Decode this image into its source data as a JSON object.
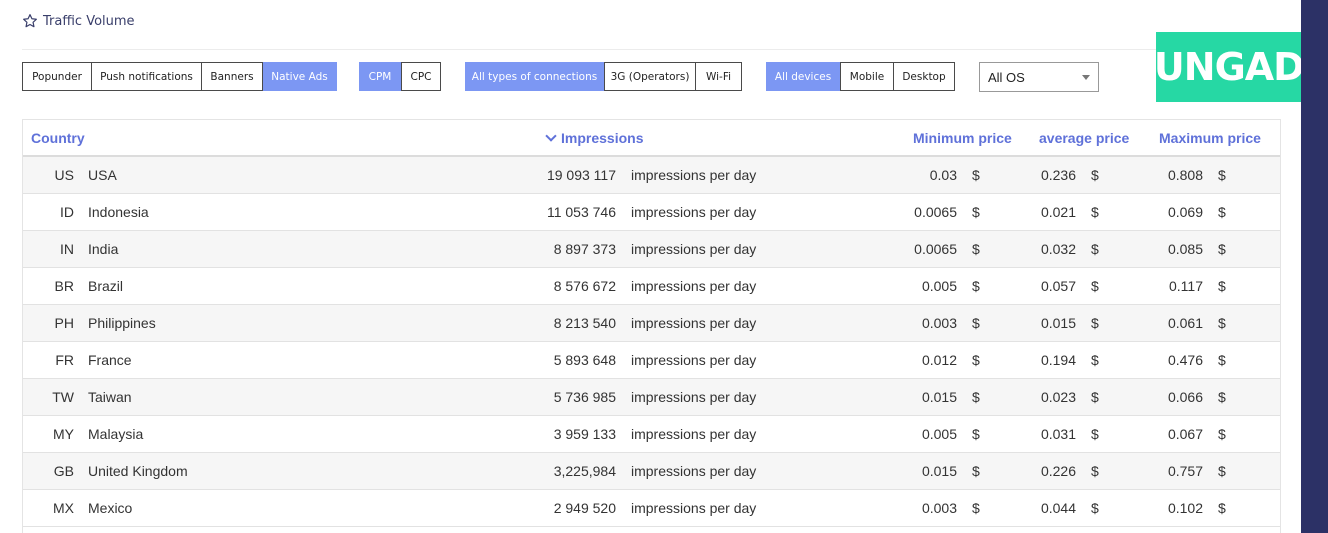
{
  "header": {
    "title": "Traffic Volume"
  },
  "filters": {
    "ad_formats": [
      {
        "label": "Popunder",
        "active": false
      },
      {
        "label": "Push notifications",
        "active": false
      },
      {
        "label": "Banners",
        "active": false
      },
      {
        "label": "Native Ads",
        "active": true
      }
    ],
    "pricing": [
      {
        "label": "CPM",
        "active": true
      },
      {
        "label": "CPC",
        "active": false
      }
    ],
    "connections": [
      {
        "label": "All types of connections",
        "active": true
      },
      {
        "label": "3G (Operators)",
        "active": false
      },
      {
        "label": "Wi-Fi",
        "active": false
      }
    ],
    "devices": [
      {
        "label": "All devices",
        "active": true
      },
      {
        "label": "Mobile",
        "active": false
      },
      {
        "label": "Desktop",
        "active": false
      }
    ],
    "os": {
      "selected": "All OS"
    }
  },
  "brand": {
    "logo_text": "UNGADS",
    "accent": "#26d8a4",
    "sidebar_color": "#2c3166",
    "active_button": "#7c97f3"
  },
  "table": {
    "headers": {
      "country": "Country",
      "impressions": "Impressions",
      "min_price": "Minimum price",
      "avg_price": "average price",
      "max_price": "Maximum price"
    },
    "unit_label": "impressions per day",
    "currency": "$",
    "rows": [
      {
        "code": "US",
        "name": "USA",
        "impressions": "19 093 117",
        "min": "0.03",
        "avg": "0.236",
        "max": "0.808"
      },
      {
        "code": "ID",
        "name": "Indonesia",
        "impressions": "11 053 746",
        "min": "0.0065",
        "avg": "0.021",
        "max": "0.069"
      },
      {
        "code": "IN",
        "name": "India",
        "impressions": "8 897 373",
        "min": "0.0065",
        "avg": "0.032",
        "max": "0.085"
      },
      {
        "code": "BR",
        "name": "Brazil",
        "impressions": "8 576 672",
        "min": "0.005",
        "avg": "0.057",
        "max": "0.117"
      },
      {
        "code": "PH",
        "name": "Philippines",
        "impressions": "8 213 540",
        "min": "0.003",
        "avg": "0.015",
        "max": "0.061"
      },
      {
        "code": "FR",
        "name": "France",
        "impressions": "5 893 648",
        "min": "0.012",
        "avg": "0.194",
        "max": "0.476"
      },
      {
        "code": "TW",
        "name": "Taiwan",
        "impressions": "5 736 985",
        "min": "0.015",
        "avg": "0.023",
        "max": "0.066"
      },
      {
        "code": "MY",
        "name": "Malaysia",
        "impressions": "3 959 133",
        "min": "0.005",
        "avg": "0.031",
        "max": "0.067"
      },
      {
        "code": "GB",
        "name": "United Kingdom",
        "impressions": "3,225,984",
        "min": "0.015",
        "avg": "0.226",
        "max": "0.757"
      },
      {
        "code": "MX",
        "name": "Mexico",
        "impressions": "2 949 520",
        "min": "0.003",
        "avg": "0.044",
        "max": "0.102"
      }
    ]
  }
}
